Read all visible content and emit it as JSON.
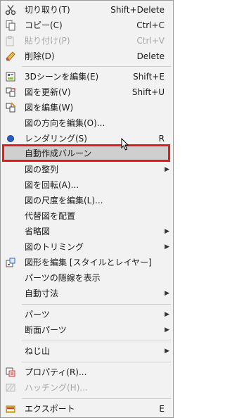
{
  "menu": {
    "items": [
      {
        "label": "切り取り(T)",
        "accel": "Shift+Delete",
        "icon": "cut-icon"
      },
      {
        "label": "コピー(C)",
        "accel": "Ctrl+C",
        "icon": "copy-icon"
      },
      {
        "label": "貼り付け(P)",
        "accel": "Ctrl+V",
        "icon": "paste-icon",
        "disabled": true
      },
      {
        "label": "削除(D)",
        "accel": "Delete",
        "icon": "eraser-icon"
      },
      {
        "label": "3Dシーンを編集(E)",
        "accel": "Shift+E",
        "icon": "3d-scene-icon"
      },
      {
        "label": "図を更新(V)",
        "accel": "Shift+U",
        "icon": "update-view-icon"
      },
      {
        "label": "図を編集(W)",
        "icon": "edit-view-icon"
      },
      {
        "label": "図の方向を編集(O)..."
      },
      {
        "label": "レンダリング(S)",
        "accel": "R",
        "icon": "rendering-icon"
      },
      {
        "label": "自動作成バルーン"
      },
      {
        "label": "図の整列"
      },
      {
        "label": "図を回転(A)..."
      },
      {
        "label": "図の尺度を編集(L)..."
      },
      {
        "label": "代替図を配置"
      },
      {
        "label": "省略図"
      },
      {
        "label": "図のトリミング"
      },
      {
        "label": "図形を編集 [スタイルとレイヤー]",
        "icon": "shape-edit-icon"
      },
      {
        "label": "パーツの隠線を表示"
      },
      {
        "label": "自動寸法"
      },
      {
        "label": "パーツ"
      },
      {
        "label": "断面パーツ"
      },
      {
        "label": "ねじ山"
      },
      {
        "label": "プロパティ(R)...",
        "icon": "properties-icon"
      },
      {
        "label": "ハッチング(H)...",
        "icon": "hatching-icon",
        "disabled": true
      },
      {
        "label": "エクスポート",
        "accel": "E",
        "icon": "export-icon"
      }
    ],
    "highlighted": "自動作成バルーン",
    "submenu_arrow": "▶",
    "colors": {
      "highlight_border": "#e41b1b",
      "highlight_fill": "#cfcfcf",
      "background": "#f2f2f2"
    }
  }
}
